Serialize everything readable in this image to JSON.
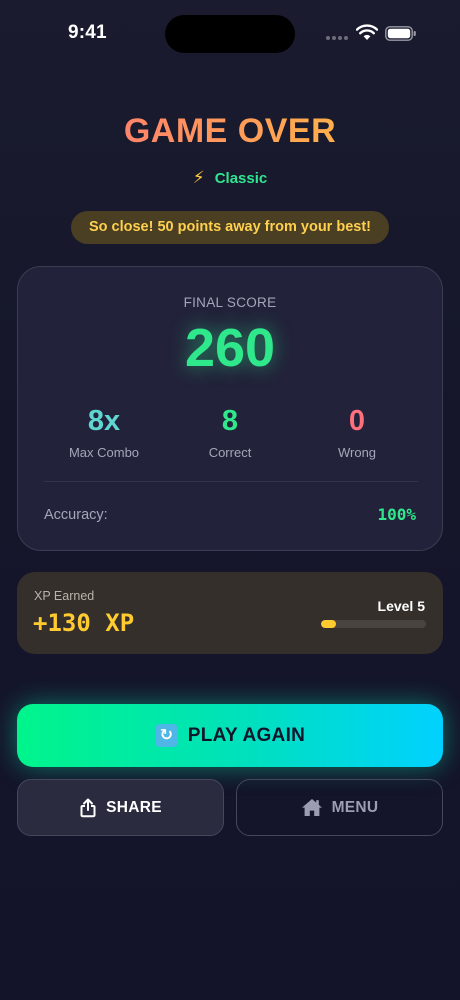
{
  "status_bar": {
    "time": "9:41"
  },
  "header": {
    "title": "GAME OVER",
    "mode_icon": "lightning-icon",
    "mode_glyph": "⚡",
    "mode_label": "Classic"
  },
  "toast": {
    "message": "So close! 50 points away from your best!"
  },
  "score_card": {
    "final_label": "FINAL SCORE",
    "final_score": "260",
    "stats": [
      {
        "value": "8x",
        "label": "Max Combo",
        "color": "#5fd6cf"
      },
      {
        "value": "8",
        "label": "Correct",
        "color": "#2fe88c"
      },
      {
        "value": "0",
        "label": "Wrong",
        "color": "#ff6f7c"
      }
    ],
    "accuracy_label": "Accuracy:",
    "accuracy_value": "100%"
  },
  "xp_card": {
    "label": "XP Earned",
    "value": "+130 XP",
    "level_label": "Level 5",
    "progress_fraction": 0.14
  },
  "buttons": {
    "play_again": {
      "label": "PLAY AGAIN",
      "icon": "refresh-icon",
      "glyph": "↻"
    },
    "share": {
      "label": "SHARE",
      "icon": "share-icon"
    },
    "menu": {
      "label": "MENU",
      "icon": "home-icon"
    }
  },
  "colors": {
    "accent_green": "#2fe88c",
    "accent_gold": "#ffcb2e",
    "background": "#15162a"
  }
}
